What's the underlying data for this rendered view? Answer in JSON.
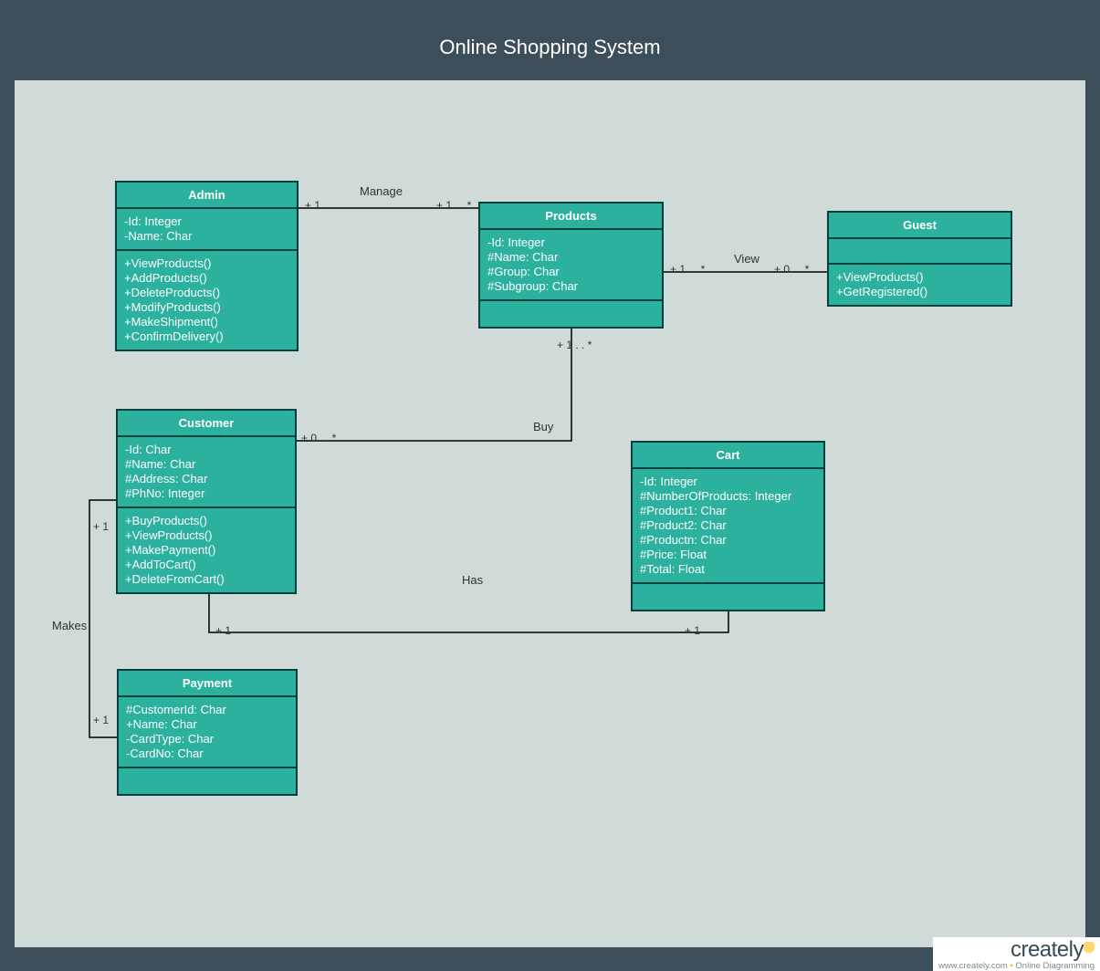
{
  "title": "Online Shopping System",
  "classes": {
    "admin": {
      "name": "Admin",
      "attrs": [
        "-Id: Integer",
        "-Name: Char"
      ],
      "ops": [
        "+ViewProducts()",
        "+AddProducts()",
        "+DeleteProducts()",
        "+ModifyProducts()",
        "+MakeShipment()",
        "+ConfirmDelivery()"
      ]
    },
    "products": {
      "name": "Products",
      "attrs": [
        "-Id: Integer",
        "#Name: Char",
        "#Group: Char",
        "#Subgroup: Char"
      ],
      "ops": []
    },
    "guest": {
      "name": "Guest",
      "attrs": [],
      "ops": [
        "+ViewProducts()",
        "+GetRegistered()"
      ]
    },
    "customer": {
      "name": "Customer",
      "attrs": [
        "-Id: Char",
        "#Name: Char",
        "#Address: Char",
        "#PhNo: Integer"
      ],
      "ops": [
        "+BuyProducts()",
        "+ViewProducts()",
        "+MakePayment()",
        "+AddToCart()",
        "+DeleteFromCart()"
      ]
    },
    "cart": {
      "name": "Cart",
      "attrs": [
        "-Id: Integer",
        "#NumberOfProducts: Integer",
        "#Product1: Char",
        "#Product2: Char",
        "#Productn: Char",
        "#Price: Float",
        "#Total: Float"
      ],
      "ops": []
    },
    "payment": {
      "name": "Payment",
      "attrs": [
        "#CustomerId: Char",
        "+Name: Char",
        "-CardType: Char",
        "-CardNo: Char"
      ],
      "ops": []
    }
  },
  "relations": {
    "manage": {
      "label": "Manage",
      "m1": "+ 1",
      "m2": "+ 1 . . *"
    },
    "view": {
      "label": "View",
      "m1": "+ 1 . . *",
      "m2": "+ 0 . . *"
    },
    "buy": {
      "label": "Buy",
      "m1": "+ 1 . . *",
      "m2": "+ 0 . . *"
    },
    "has": {
      "label": "Has",
      "m1": "+ 1",
      "m2": "+ 1"
    },
    "makes": {
      "label": "Makes",
      "m1": "+ 1",
      "m2": "+ 1"
    }
  },
  "footer": {
    "brand": "creately",
    "tagline_site": "www.creately.com",
    "tagline_text": "Online Diagramming"
  }
}
